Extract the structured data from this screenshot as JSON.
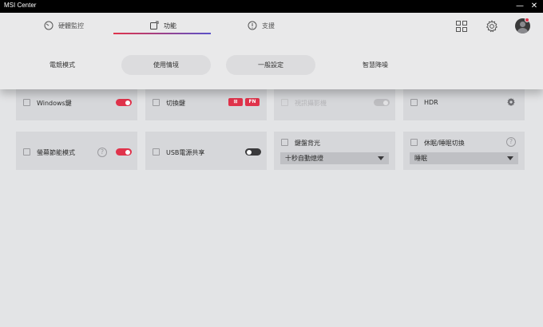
{
  "window": {
    "title": "MSI Center",
    "minimize": "—",
    "close": "✕"
  },
  "tabs": [
    {
      "label": "硬體監控",
      "icon": "gauge-icon"
    },
    {
      "label": "功能",
      "icon": "feature-icon",
      "active": true
    },
    {
      "label": "支援",
      "icon": "support-icon"
    }
  ],
  "toolbar_icons": [
    "grid-icon",
    "gear-icon",
    "avatar-icon"
  ],
  "subtabs": [
    {
      "label": "電競模式"
    },
    {
      "label": "使用情境"
    },
    {
      "label": "一般設定"
    },
    {
      "label": "智慧降噪"
    }
  ],
  "cards": [
    {
      "label": "Windows鍵",
      "icon": "windows-key-icon",
      "toggle": "on",
      "enabled": true
    },
    {
      "label": "切換鍵",
      "icon": "swap-key-icon",
      "segments": [
        "⊞",
        "FN"
      ],
      "enabled": true
    },
    {
      "label": "視訊攝影機",
      "icon": "camera-icon",
      "toggle": "on",
      "enabled": false
    },
    {
      "label": "HDR",
      "icon": "hdr-icon",
      "settings_icon": "gear-icon",
      "enabled": true
    },
    {
      "label": "螢幕節能模式",
      "icon": "monitor-icon",
      "help": "?",
      "toggle": "on",
      "enabled": true
    },
    {
      "label": "USB電源共享",
      "icon": "usb-icon",
      "toggle": "off",
      "enabled": true
    },
    {
      "label": "鍵盤背光",
      "icon": "keyboard-icon",
      "select_value": "十秒自動熄燈",
      "enabled": true
    },
    {
      "label": "休眠/睡眠切換",
      "icon": "sleep-icon",
      "help": "?",
      "select_value": "睡眠",
      "enabled": true
    }
  ],
  "colors": {
    "accent": "#e0334b",
    "accent_secondary": "#5a50c8",
    "background": "#e3e4e6",
    "card": "#d6d7da"
  }
}
